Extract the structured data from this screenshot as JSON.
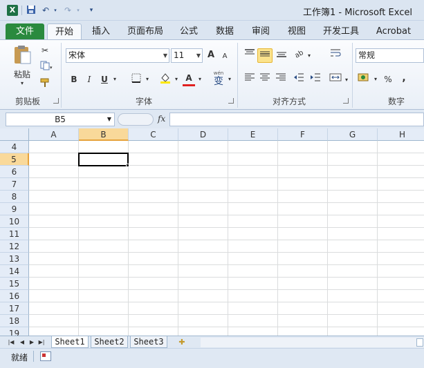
{
  "window": {
    "title": "工作簿1 - Microsoft Excel",
    "app_icon": "X"
  },
  "quick_access": {
    "save_icon": "floppy-disk-icon",
    "undo_icon": "undo-arrow-icon",
    "redo_icon": "redo-arrow-icon",
    "customize_icon": "customize-dropdown-icon"
  },
  "ribbon_tabs": {
    "file": "文件",
    "home": "开始",
    "insert": "插入",
    "page_layout": "页面布局",
    "formulas": "公式",
    "data": "数据",
    "review": "审阅",
    "view": "视图",
    "developer": "开发工具",
    "acrobat": "Acrobat"
  },
  "clipboard": {
    "paste_label": "粘贴",
    "group_label": "剪贴板"
  },
  "font_group": {
    "font_name": "宋体",
    "font_size": "11",
    "bold": "B",
    "italic": "I",
    "underline": "U",
    "grow": "A",
    "shrink": "A",
    "font_color_glyph": "A",
    "phonetic_glyph": "变",
    "phonetic_top": "wén",
    "group_label": "字体"
  },
  "alignment_group": {
    "group_label": "对齐方式"
  },
  "number_group": {
    "format": "常规",
    "percent": "%",
    "comma": ",",
    "group_label": "数字"
  },
  "formula_bar": {
    "name_box": "B5",
    "fx": "fx",
    "formula": ""
  },
  "grid": {
    "columns": [
      "A",
      "B",
      "C",
      "D",
      "E",
      "F",
      "G",
      "H"
    ],
    "rows": [
      "4",
      "5",
      "6",
      "7",
      "8",
      "9",
      "10",
      "11",
      "12",
      "13",
      "14",
      "15",
      "16",
      "17",
      "18",
      "19"
    ],
    "selected_column": "B",
    "selected_row": "5"
  },
  "sheets": {
    "tabs": [
      "Sheet1",
      "Sheet2",
      "Sheet3"
    ],
    "active": "Sheet1"
  },
  "status": {
    "ready": "就绪"
  },
  "colors": {
    "file_tab": "#2a8a3e",
    "selection_header": "#f9d99a",
    "ribbon_bg": "#dbe5f1"
  }
}
